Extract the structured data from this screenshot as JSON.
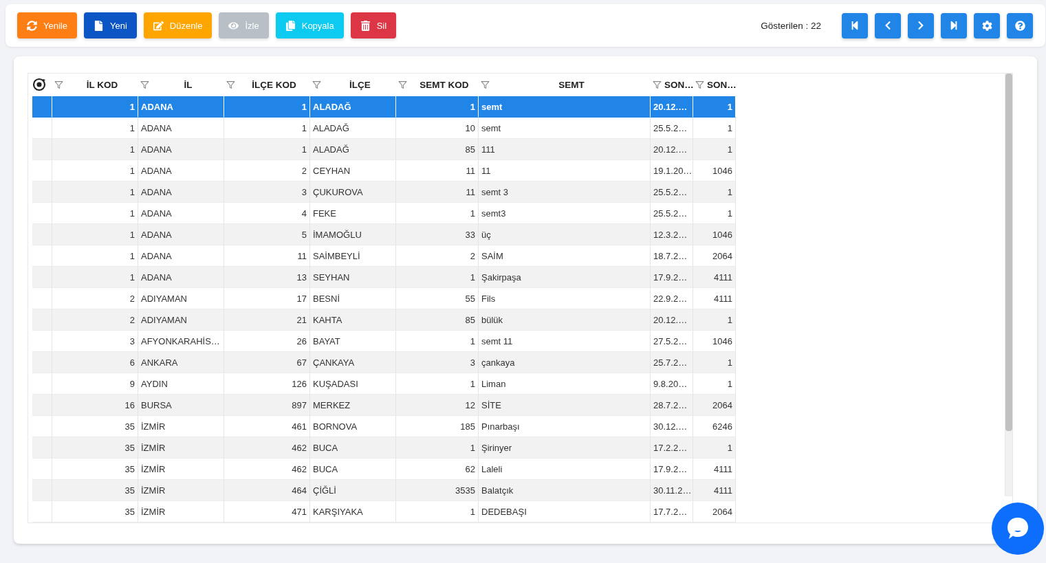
{
  "toolbar": {
    "buttons": [
      {
        "label": "Yenile",
        "kind": "refresh",
        "disabled": false
      },
      {
        "label": "Yeni",
        "kind": "new",
        "disabled": false
      },
      {
        "label": "Düzenle",
        "kind": "edit",
        "disabled": false
      },
      {
        "label": "İzle",
        "kind": "view",
        "disabled": true
      },
      {
        "label": "Kopyala",
        "kind": "copy",
        "disabled": false
      },
      {
        "label": "Sil",
        "kind": "delete",
        "disabled": false
      }
    ],
    "count_label": "Gösterilen : 22",
    "nav_buttons": [
      {
        "kind": "first"
      },
      {
        "kind": "prev"
      },
      {
        "kind": "next"
      },
      {
        "kind": "last"
      },
      {
        "kind": "settings"
      },
      {
        "kind": "help"
      }
    ]
  },
  "table": {
    "columns": [
      {
        "label": "İL KOD"
      },
      {
        "label": "İL"
      },
      {
        "label": "İLÇE KOD"
      },
      {
        "label": "İLÇE"
      },
      {
        "label": "SEMT KOD"
      },
      {
        "label": "SEMT"
      },
      {
        "label": "SON…"
      },
      {
        "label": "SON…"
      }
    ],
    "rows": [
      {
        "selected": true,
        "cells": [
          "1",
          "ADANA",
          "1",
          "ALADAĞ",
          "1",
          "semt",
          "20.12.…",
          "1"
        ]
      },
      {
        "selected": false,
        "cells": [
          "1",
          "ADANA",
          "1",
          "ALADAĞ",
          "10",
          "semt",
          "25.5.2…",
          "1"
        ]
      },
      {
        "selected": false,
        "cells": [
          "1",
          "ADANA",
          "1",
          "ALADAĞ",
          "85",
          "111",
          "20.12.…",
          "1"
        ]
      },
      {
        "selected": false,
        "cells": [
          "1",
          "ADANA",
          "2",
          "CEYHAN",
          "11",
          "11",
          "19.1.20…",
          "1046"
        ]
      },
      {
        "selected": false,
        "cells": [
          "1",
          "ADANA",
          "3",
          "ÇUKUROVA",
          "11",
          "semt 3",
          "25.5.2…",
          "1"
        ]
      },
      {
        "selected": false,
        "cells": [
          "1",
          "ADANA",
          "4",
          "FEKE",
          "1",
          "semt3",
          "25.5.2…",
          "1"
        ]
      },
      {
        "selected": false,
        "cells": [
          "1",
          "ADANA",
          "5",
          "İMAMOĞLU",
          "33",
          "üç",
          "12.3.2…",
          "1046"
        ]
      },
      {
        "selected": false,
        "cells": [
          "1",
          "ADANA",
          "11",
          "SAİMBEYLİ",
          "2",
          "SAİM",
          "18.7.2…",
          "2064"
        ]
      },
      {
        "selected": false,
        "cells": [
          "1",
          "ADANA",
          "13",
          "SEYHAN",
          "1",
          "Şakirpaşa",
          "17.9.2…",
          "4111"
        ]
      },
      {
        "selected": false,
        "cells": [
          "2",
          "ADIYAMAN",
          "17",
          "BESNİ",
          "55",
          "Fils",
          "22.9.2…",
          "4111"
        ]
      },
      {
        "selected": false,
        "cells": [
          "2",
          "ADIYAMAN",
          "21",
          "KAHTA",
          "85",
          "bülük",
          "20.12.…",
          "1"
        ]
      },
      {
        "selected": false,
        "cells": [
          "3",
          "AFYONKARAHİS…",
          "26",
          "BAYAT",
          "1",
          "semt 11",
          "27.5.2…",
          "1046"
        ]
      },
      {
        "selected": false,
        "cells": [
          "6",
          "ANKARA",
          "67",
          "ÇANKAYA",
          "3",
          "çankaya",
          "25.7.2…",
          "1"
        ]
      },
      {
        "selected": false,
        "cells": [
          "9",
          "AYDIN",
          "126",
          "KUŞADASI",
          "1",
          "Liman",
          "9.8.20…",
          "1"
        ]
      },
      {
        "selected": false,
        "cells": [
          "16",
          "BURSA",
          "897",
          "MERKEZ",
          "12",
          "SİTE",
          "28.7.2…",
          "2064"
        ]
      },
      {
        "selected": false,
        "cells": [
          "35",
          "İZMİR",
          "461",
          "BORNOVA",
          "185",
          "Pınarbaşı",
          "30.12.…",
          "6246"
        ]
      },
      {
        "selected": false,
        "cells": [
          "35",
          "İZMİR",
          "462",
          "BUCA",
          "1",
          "Şirinyer",
          "17.2.2…",
          "1"
        ]
      },
      {
        "selected": false,
        "cells": [
          "35",
          "İZMİR",
          "462",
          "BUCA",
          "62",
          "Laleli",
          "17.9.2…",
          "4111"
        ]
      },
      {
        "selected": false,
        "cells": [
          "35",
          "İZMİR",
          "464",
          "ÇİĞLİ",
          "3535",
          "Balatçık",
          "30.11.2…",
          "4111"
        ]
      },
      {
        "selected": false,
        "cells": [
          "35",
          "İZMİR",
          "471",
          "KARŞIYAKA",
          "1",
          "DEDEBAŞI",
          "17.7.2…",
          "2064"
        ]
      }
    ]
  }
}
